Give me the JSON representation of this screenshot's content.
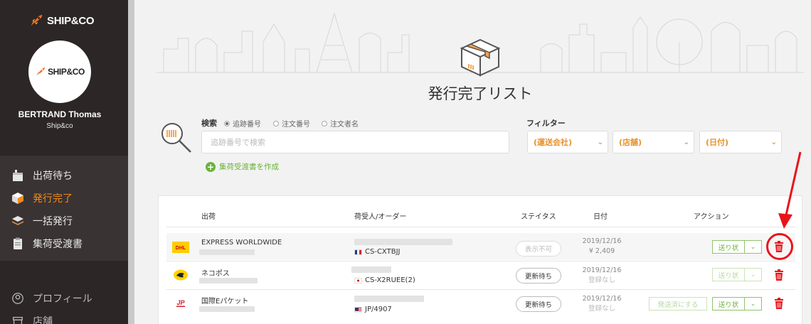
{
  "brand": {
    "name": "SHIP&CO"
  },
  "user": {
    "name": "BERTRAND Thomas",
    "org": "Ship&co",
    "avatar_text": "SHIP&CO"
  },
  "nav": {
    "items": [
      {
        "label": "出荷待ち",
        "icon": "box-pending-icon",
        "active": false
      },
      {
        "label": "発行完了",
        "icon": "box-done-icon",
        "active": true
      },
      {
        "label": "一括発行",
        "icon": "layers-icon",
        "active": false
      },
      {
        "label": "集荷受渡書",
        "icon": "clipboard-icon",
        "active": false
      }
    ],
    "bottom": [
      {
        "label": "プロフィール",
        "icon": "profile-icon"
      },
      {
        "label": "店舗",
        "icon": "store-icon"
      }
    ]
  },
  "page": {
    "title": "発行完了リスト"
  },
  "search": {
    "label": "検索",
    "radios": [
      "追跡番号",
      "注文番号",
      "注文者名"
    ],
    "selected": "追跡番号",
    "placeholder": "追跡番号で検索",
    "create_link": "集荷受渡書を作成"
  },
  "filter": {
    "label": "フィルター",
    "carrier": "(運送会社)",
    "store": "(店舗)",
    "date": "(日付)"
  },
  "table": {
    "headers": {
      "shipment": "出荷",
      "recipient": "荷受人/オーダー",
      "status": "ステイタス",
      "date": "日付",
      "action": "アクション"
    },
    "rows": [
      {
        "service": "EXPRESS WORLDWIDE",
        "order": "CS-CXTBJJ",
        "flag": "fr",
        "status": "表示不可",
        "date": "2019/12/16",
        "amount": "¥ 2,409",
        "carrier": "DHL"
      },
      {
        "service": "ネコポス",
        "order": "CS-X2RUEE(2)",
        "flag": "jp",
        "status": "更新待ち",
        "date": "2019/12/16",
        "amount": "登録なし",
        "carrier": "Yamato"
      },
      {
        "service": "国際Eパケット",
        "order": "JP/4907",
        "flag": "us",
        "status": "更新待ち",
        "date": "2019/12/16",
        "amount": "登録なし",
        "carrier": "JP Post"
      }
    ],
    "send_label": "送り状",
    "mark_sent_label": "発送済にする"
  },
  "colors": {
    "accent": "#f08c1a",
    "sidebar": "#2c2626",
    "green": "#6bb33b",
    "red": "#e8141a"
  }
}
